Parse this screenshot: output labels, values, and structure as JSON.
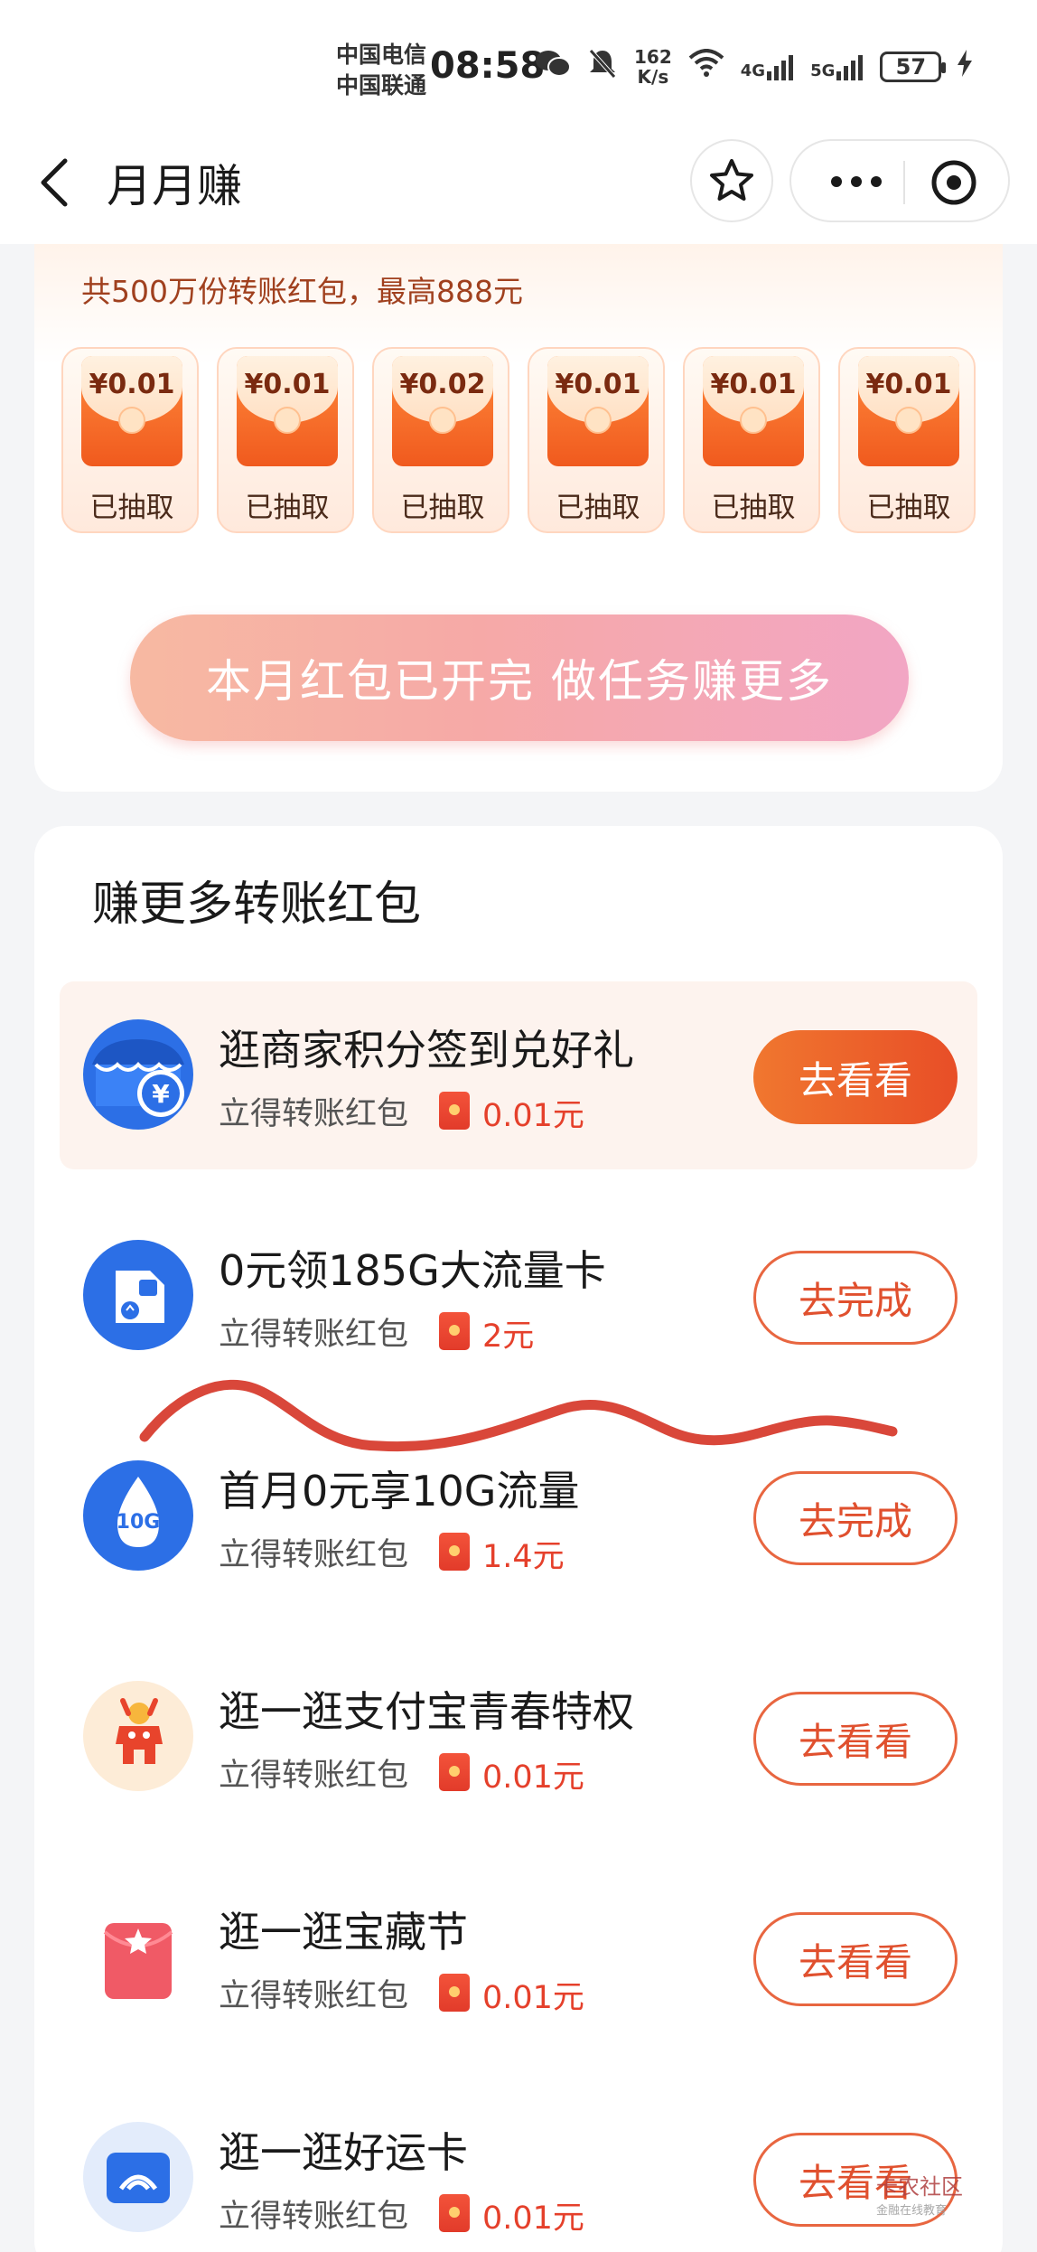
{
  "status_bar": {
    "carrier1": "中国电信",
    "carrier2": "中国联通",
    "time": "08:58",
    "net_speed_value": "162",
    "net_speed_unit": "K/s",
    "signal1": "4G",
    "signal2": "5G",
    "battery": "57"
  },
  "nav": {
    "title": "月月赚"
  },
  "top_card": {
    "subtitle": "共500万份转账红包，最高888元",
    "envelopes": [
      {
        "amount": "¥0.01",
        "status": "已抽取"
      },
      {
        "amount": "¥0.01",
        "status": "已抽取"
      },
      {
        "amount": "¥0.02",
        "status": "已抽取"
      },
      {
        "amount": "¥0.01",
        "status": "已抽取"
      },
      {
        "amount": "¥0.01",
        "status": "已抽取"
      },
      {
        "amount": "¥0.01",
        "status": "已抽取"
      }
    ],
    "button_label": "本月红包已开完 做任务赚更多"
  },
  "tasks_section": {
    "title": "赚更多转账红包",
    "tasks": [
      {
        "name": "逛商家积分签到兑好礼",
        "subtitle": "立得转账红包",
        "reward": "0.01元",
        "button": "去看看",
        "icon": "shop-yuan-icon"
      },
      {
        "name": "0元领185G大流量卡",
        "subtitle": "立得转账红包",
        "reward": "2元",
        "button": "去完成",
        "icon": "sim-card-icon"
      },
      {
        "name": "首月0元享10G流量",
        "subtitle": "立得转账红包",
        "reward": "1.4元",
        "button": "去完成",
        "icon": "data-drop-icon",
        "icon_text": "10G"
      },
      {
        "name": "逛一逛支付宝青春特权",
        "subtitle": "立得转账红包",
        "reward": "0.01元",
        "button": "去看看",
        "icon": "youth-mascot-icon"
      },
      {
        "name": "逛一逛宝藏节",
        "subtitle": "立得转账红包",
        "reward": "0.01元",
        "button": "去看看",
        "icon": "treasure-envelope-icon"
      },
      {
        "name": "逛一逛好运卡",
        "subtitle": "立得转账红包",
        "reward": "0.01元",
        "button": "去看看",
        "icon": "lucky-card-icon"
      }
    ]
  },
  "watermark": {
    "text": "卡农社区",
    "sub": "金融在线教育"
  },
  "colors": {
    "accent": "#e8542a",
    "reward_red": "#e5402b",
    "scribble": "#d9473a"
  }
}
